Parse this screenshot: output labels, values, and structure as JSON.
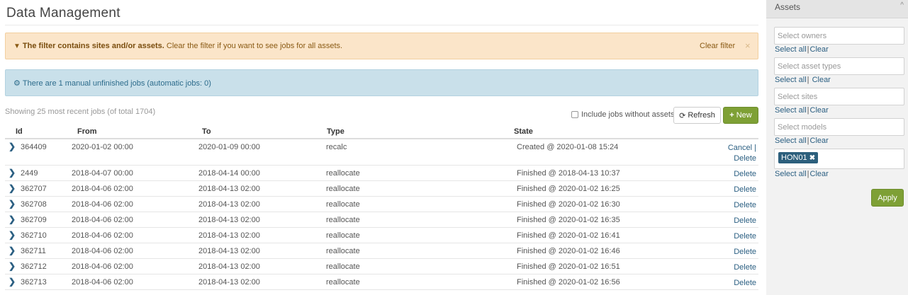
{
  "page": {
    "title": "Data Management"
  },
  "filter_alert": {
    "bold": "The filter contains sites and/or assets.",
    "text": "Clear the filter if you want to see jobs for all assets.",
    "clear_label": "Clear filter",
    "close": "×",
    "icon": "filter-icon"
  },
  "info_alert": {
    "text": "There are 1 manual unfinished jobs (automatic jobs: 0)",
    "icon": "cogs-icon"
  },
  "toolbar": {
    "showing": "Showing 25 most recent jobs (of total 1704)",
    "include_label": "Include jobs without assets",
    "refresh_label": "Refresh",
    "new_label": "New"
  },
  "table": {
    "headers": {
      "id": "Id",
      "from": "From",
      "to": "To",
      "type": "Type",
      "state": "State"
    },
    "rows": [
      {
        "id": "364409",
        "from": "2020-01-02 00:00",
        "to": "2020-01-09 00:00",
        "type": "recalc",
        "state": "Created @ 2020-01-08 15:24",
        "action1": "Cancel |",
        "action2": "Delete"
      },
      {
        "id": "2449",
        "from": "2018-04-07 00:00",
        "to": "2018-04-14 00:00",
        "type": "reallocate",
        "state": "Finished @ 2018-04-13 10:37",
        "action2": "Delete"
      },
      {
        "id": "362707",
        "from": "2018-04-06 02:00",
        "to": "2018-04-13 02:00",
        "type": "reallocate",
        "state": "Finished @ 2020-01-02 16:25",
        "action2": "Delete"
      },
      {
        "id": "362708",
        "from": "2018-04-06 02:00",
        "to": "2018-04-13 02:00",
        "type": "reallocate",
        "state": "Finished @ 2020-01-02 16:30",
        "action2": "Delete"
      },
      {
        "id": "362709",
        "from": "2018-04-06 02:00",
        "to": "2018-04-13 02:00",
        "type": "reallocate",
        "state": "Finished @ 2020-01-02 16:35",
        "action2": "Delete"
      },
      {
        "id": "362710",
        "from": "2018-04-06 02:00",
        "to": "2018-04-13 02:00",
        "type": "reallocate",
        "state": "Finished @ 2020-01-02 16:41",
        "action2": "Delete"
      },
      {
        "id": "362711",
        "from": "2018-04-06 02:00",
        "to": "2018-04-13 02:00",
        "type": "reallocate",
        "state": "Finished @ 2020-01-02 16:46",
        "action2": "Delete"
      },
      {
        "id": "362712",
        "from": "2018-04-06 02:00",
        "to": "2018-04-13 02:00",
        "type": "reallocate",
        "state": "Finished @ 2020-01-02 16:51",
        "action2": "Delete"
      },
      {
        "id": "362713",
        "from": "2018-04-06 02:00",
        "to": "2018-04-13 02:00",
        "type": "reallocate",
        "state": "Finished @ 2020-01-02 16:56",
        "action2": "Delete"
      }
    ]
  },
  "sidebar": {
    "title": "Assets",
    "select_all": "Select all",
    "clear": "Clear",
    "owners_placeholder": "Select owners",
    "types_placeholder": "Select asset types",
    "sites_placeholder": "Select sites",
    "models_placeholder": "Select models",
    "asset_chip": "HON01",
    "apply_label": "Apply"
  },
  "colors": {
    "accent_green": "#7ea035",
    "link_blue": "#2b5f82",
    "warning_bg": "#fbe5c9",
    "info_bg": "#c9e0ea"
  }
}
